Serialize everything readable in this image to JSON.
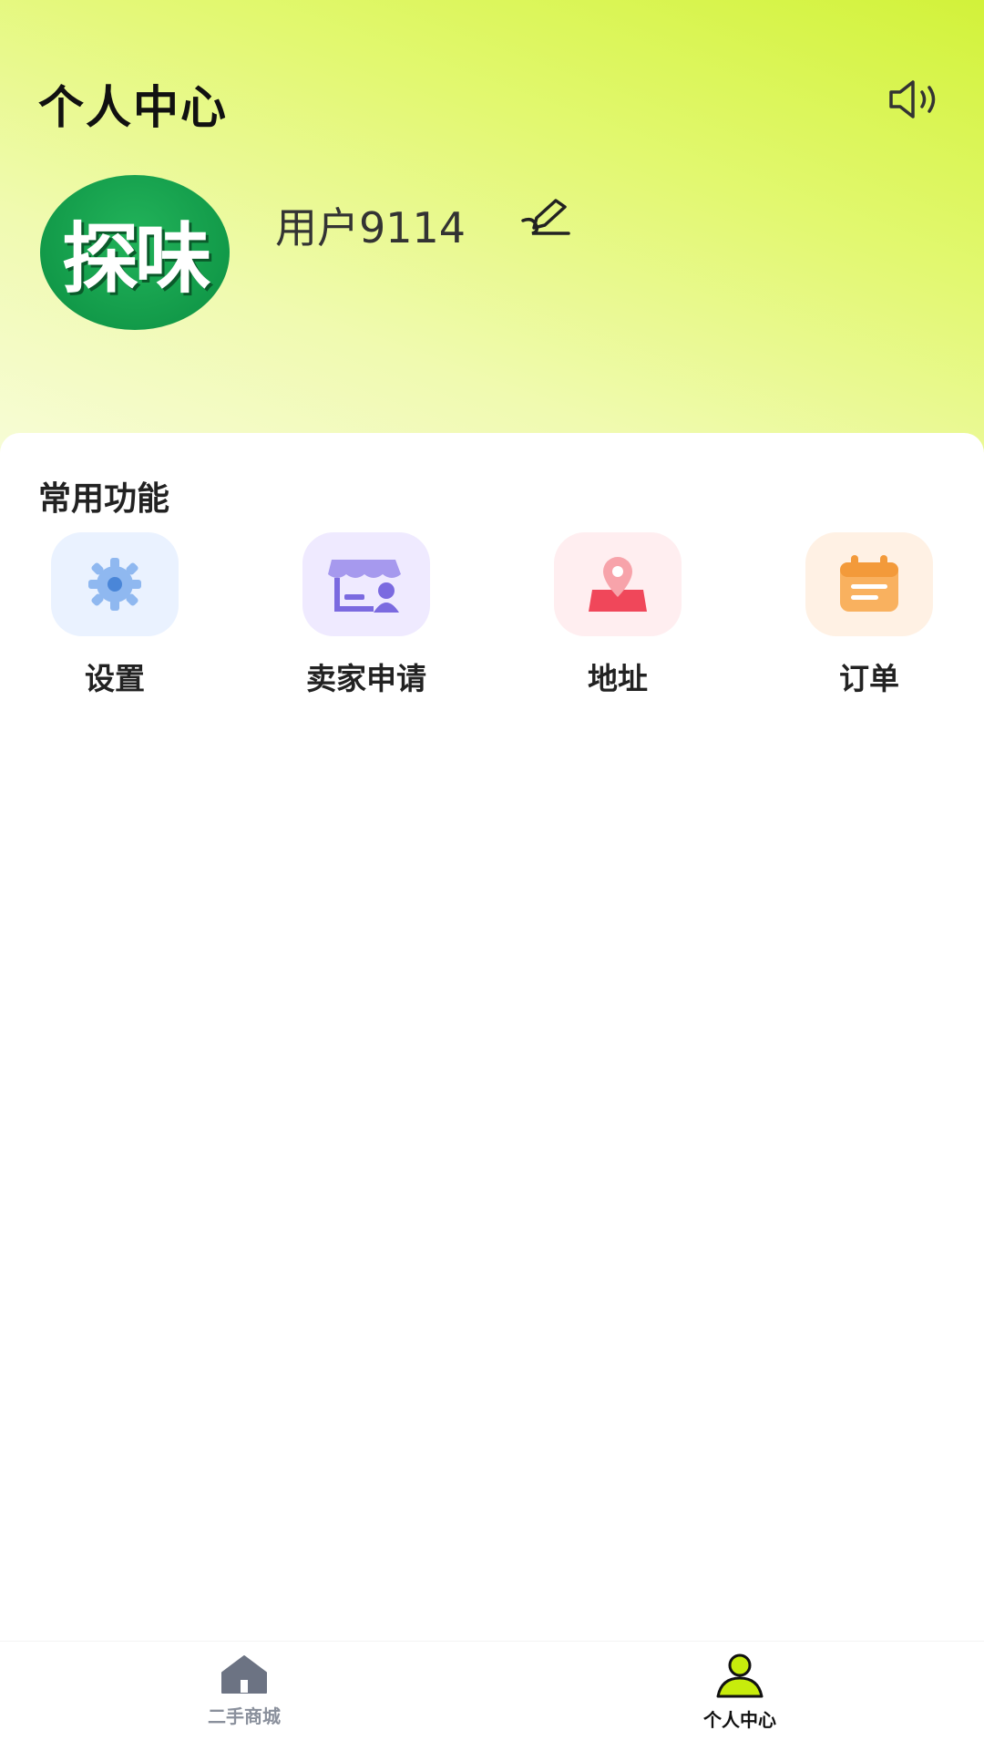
{
  "header": {
    "title": "个人中心",
    "speaker_icon": "speaker-icon",
    "gradient_colors": [
      "#d2f23a",
      "#f7fcd6"
    ]
  },
  "profile": {
    "avatar_text": "探味",
    "username": "用户9114",
    "edit_icon": "edit-icon"
  },
  "functions": {
    "section_title": "常用功能",
    "items": [
      {
        "label": "设置",
        "icon": "gear-icon",
        "bg": "#eaf2ff"
      },
      {
        "label": "卖家申请",
        "icon": "store-icon",
        "bg": "#efeaff"
      },
      {
        "label": "地址",
        "icon": "location-pin-icon",
        "bg": "#ffeef0"
      },
      {
        "label": "订单",
        "icon": "order-icon",
        "bg": "#fff1e4"
      }
    ]
  },
  "tabbar": {
    "items": [
      {
        "label": "二手商城",
        "icon": "home-icon",
        "active": false,
        "color": "#6c7383"
      },
      {
        "label": "个人中心",
        "icon": "user-icon",
        "active": true,
        "color": "#111111",
        "accent": "#c7ec0c"
      }
    ]
  }
}
